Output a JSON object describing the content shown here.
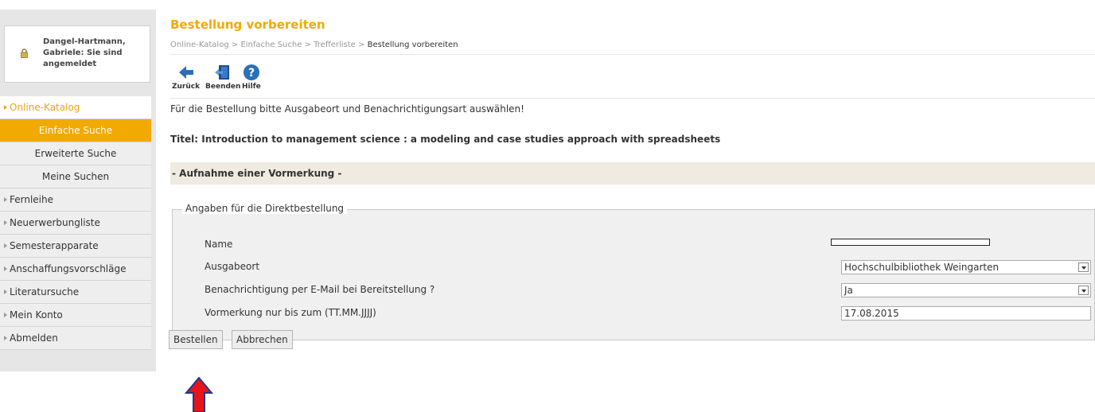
{
  "user": {
    "login_status": "Dangel-Hartmann, Gabriele: Sie sind angemeldet"
  },
  "sidebar": {
    "items": [
      {
        "label": "Online-Katalog",
        "level": "top",
        "selected": true
      },
      {
        "label": "Einfache Suche",
        "level": "sub",
        "active": true
      },
      {
        "label": "Erweiterte Suche",
        "level": "sub"
      },
      {
        "label": "Meine Suchen",
        "level": "sub"
      },
      {
        "label": "Fernleihe",
        "level": "top"
      },
      {
        "label": "Neuerwerbungliste",
        "level": "top"
      },
      {
        "label": "Semesterapparate",
        "level": "top"
      },
      {
        "label": "Anschaffungsvorschläge",
        "level": "top"
      },
      {
        "label": "Literatursuche",
        "level": "top"
      },
      {
        "label": "Mein Konto",
        "level": "top"
      },
      {
        "label": "Abmelden",
        "level": "top"
      }
    ]
  },
  "page": {
    "title": "Bestellung vorbereiten",
    "breadcrumb": [
      "Online-Katalog",
      "Einfache Suche",
      "Trefferliste",
      "Bestellung vorbereiten"
    ],
    "breadcrumb_separator": ">"
  },
  "toolbar": {
    "back_label": "Zurück",
    "exit_label": "Beenden",
    "help_label": "Hilfe"
  },
  "content": {
    "instruction": "Für die Bestellung bitte Ausgabeort und Benachrichtigungsart auswählen!",
    "title_line": "Titel: Introduction to management science : a modeling and case studies approach with spreadsheets",
    "section_header": "- Aufnahme einer Vormerkung -",
    "fieldset_legend": "Angaben für die Direktbestellung"
  },
  "form": {
    "name_label": "Name",
    "pickup_label": "Ausgabeort",
    "pickup_value": "Hochschulbibliothek Weingarten",
    "notify_label": "Benachrichtigung per E-Mail bei Bereitstellung ?",
    "notify_value": "Ja",
    "reserve_until_label": "Vormerkung nur bis zum (TT.MM.JJJJ)",
    "reserve_until_value": "17.08.2015"
  },
  "buttons": {
    "order": "Bestellen",
    "cancel": "Abbrechen"
  },
  "colors": {
    "accent": "#f2a900",
    "annotation_arrow": "#e8141c",
    "section_bg": "#f0ebe0"
  }
}
